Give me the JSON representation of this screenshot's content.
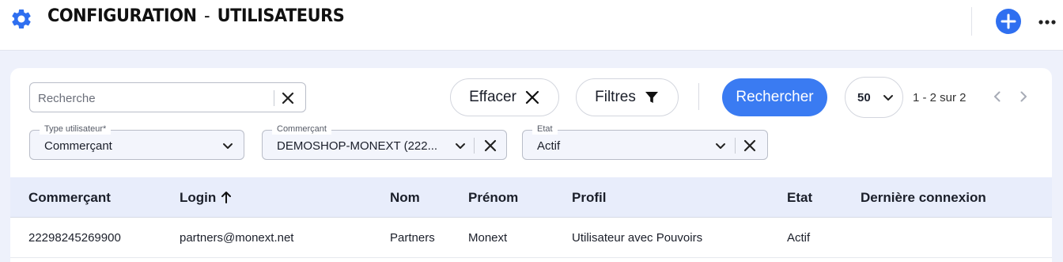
{
  "header": {
    "title_main": "CONFIGURATION",
    "title_sep": "-",
    "title_sub": "UTILISATEURS",
    "brand_color": "#2f6ff0"
  },
  "toolbar": {
    "search_placeholder": "Recherche",
    "clear_label": "Effacer",
    "filters_label": "Filtres",
    "search_button_label": "Rechercher",
    "page_size": "50",
    "range_text": "1 - 2 sur 2"
  },
  "filters": [
    {
      "label": "Type utilisateur*",
      "value": "Commerçant"
    },
    {
      "label": "Commerçant",
      "value": "DEMOSHOP-MONEXT (222..."
    },
    {
      "label": "Etat",
      "value": "Actif"
    }
  ],
  "table": {
    "columns": [
      "Commerçant",
      "Login",
      "Nom",
      "Prénom",
      "Profil",
      "Etat",
      "Dernière connexion"
    ],
    "sorted_column": "Login",
    "sort_direction": "ascending",
    "rows": [
      [
        "22298245269900",
        "partners@monext.net",
        "Partners",
        "Monext",
        "Utilisateur avec Pouvoirs",
        "Actif",
        ""
      ]
    ]
  }
}
